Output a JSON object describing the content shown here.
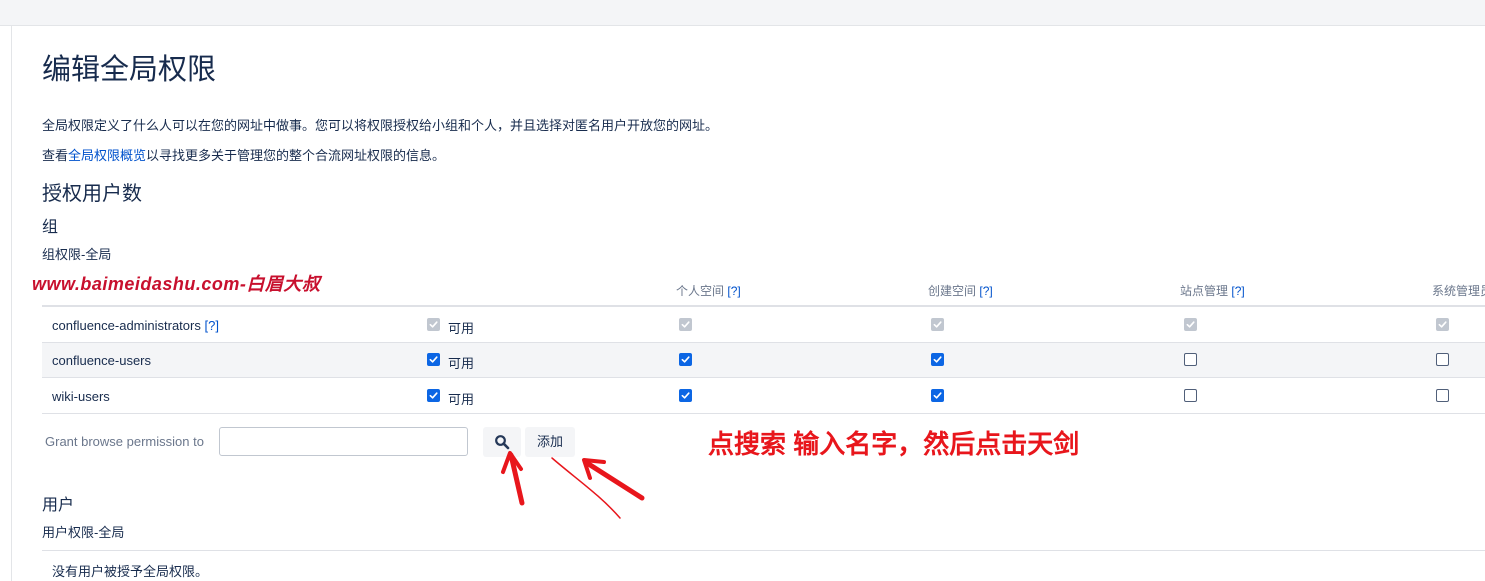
{
  "page": {
    "title": "编辑全局权限",
    "description": "全局权限定义了什么人可以在您的网址中做事。您可以将权限授权给小组和个人，并且选择对匿名用户开放您的网址。",
    "overview_prefix": "查看",
    "overview_link": "全局权限概览",
    "overview_suffix": "以寻找更多关于管理您的整个合流网址权限的信息。",
    "licensed_users_heading": "授权用户数"
  },
  "groups": {
    "heading": "组",
    "subheading": "组权限-全局",
    "columns": [
      {
        "label": "个人空间",
        "help": "[?]"
      },
      {
        "label": "创建空间",
        "help": "[?]"
      },
      {
        "label": "站点管理",
        "help": "[?]"
      },
      {
        "label": "系统管理员"
      }
    ],
    "rows": [
      {
        "name": "confluence-administrators",
        "help": "[?]",
        "can_use": "可用",
        "perms": [
          "disabled-checked",
          "disabled-checked",
          "disabled-checked",
          "disabled-checked",
          "disabled-checked"
        ]
      },
      {
        "name": "confluence-users",
        "can_use": "可用",
        "perms": [
          "checked",
          "checked",
          "checked",
          "unchecked",
          "unchecked"
        ]
      },
      {
        "name": "wiki-users",
        "can_use": "可用",
        "perms": [
          "checked",
          "checked",
          "checked",
          "unchecked",
          "unchecked"
        ]
      }
    ],
    "grant_label": "Grant browse permission to",
    "grant_value": "",
    "add_button": "添加"
  },
  "users": {
    "heading": "用户",
    "subheading": "用户权限-全局",
    "empty_message": "没有用户被授予全局权限。"
  },
  "overlay": {
    "watermark": "www.baimeidashu.com-白眉大叔",
    "annotation": "点搜索 输入名字，然后点击天剑",
    "annotation_color": "#e8161c",
    "watermark_color": "#c8102e"
  },
  "icons": {
    "search_button": "search-icon",
    "checkbox": "check-icon"
  },
  "colors": {
    "link": "#0052cc",
    "checkbox_checked": "#0c66e4",
    "checkbox_disabled": "#c1c7d0",
    "row_alt": "#f4f5f7"
  }
}
